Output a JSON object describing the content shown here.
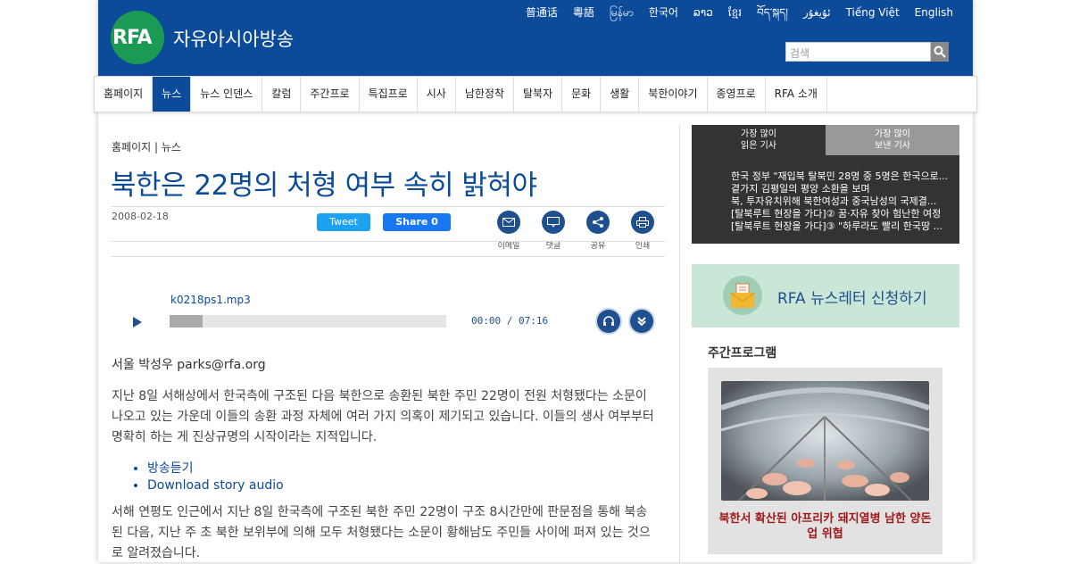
{
  "header": {
    "logo": "RFA",
    "site_name": "자유아시아방송",
    "languages": [
      "普通话",
      "粵語",
      "မြန်မာ",
      "한국어",
      "ລາວ",
      "ខ្មែរ",
      "བོད་སྐད།",
      "ئۇيغۇر",
      "Tiếng Việt",
      "English"
    ],
    "search_placeholder": "검색"
  },
  "nav": {
    "items": [
      "홈페이지",
      "뉴스",
      "뉴스 인덴스",
      "칼럼",
      "주간프로",
      "특집프로",
      "시사",
      "남한정착",
      "탈북자",
      "문화",
      "생활",
      "북한이야기",
      "종영프로",
      "RFA 소개"
    ],
    "active": "뉴스"
  },
  "article": {
    "breadcrumb": "홈페이지 | 뉴스",
    "title": "북한은 22명의 처형 여부 속히 밝혀야",
    "date": "2008-02-18",
    "tweet_label": "Tweet",
    "share_label": "Share 0",
    "tools": [
      "이메일",
      "댓글",
      "공유",
      "인쇄"
    ],
    "audio_file": "k0218ps1.mp3",
    "audio_time": "00:00 / 07:16",
    "audio_progress": 0.12,
    "byline": "서울 박성우 parks@rfa.org",
    "para1": "지난 8일 서해상에서 한국측에 구조된 다음 북한으로 송환된 북한 주민 22명이 전원 처형됐다는 소문이 나오고 있는 가운데 이들의 송환 과정 자체에 여러 가지 의혹이 제기되고 있습니다. 이들의 생사 여부부터 명확히 하는 게 진상규명의 시작이라는 지적입니다.",
    "links": [
      "방송듣기",
      "Download story audio"
    ],
    "para2": "서해 연평도 인근에서 지난 8일 한국측에 구조된 북한 주민 22명이 구조 8시간만에 판문점을 통해 북송된 다음, 지난 주 초 북한 보위부에 의해 모두 처형됐다는 소문이 황해남도 주민들 사이에 퍼져 있는 것으로 알려졌습니다."
  },
  "sidebar": {
    "tab1": [
      "가장 많이",
      "읽은 기사"
    ],
    "tab2": [
      "가장 많이",
      "보낸 기사"
    ],
    "popular": [
      "한국 정부 \"재입북 탈북민 28명 중 5명은 한국으로...",
      "곁가지 김평일의 평양 소환을 보며",
      "북, 투자유치위해 북한여성과 중국남성의 국제결...",
      "[탈북루트 현장을 가다]② 꿈·자유 찾아 험난한 여정",
      "[탈북루트 현장을 가다]③ \"하루라도 빨리 한국땅 ..."
    ],
    "newsletter": "RFA 뉴스레터 신청하기",
    "weekly_title": "주간프로그램",
    "weekly_caption": "북한서 확산된 아프리카 돼지열병 남한 양돈업 위협"
  },
  "colors": {
    "brand_blue": "#0c4a9a",
    "logo_green": "#1a9a52",
    "accent_red": "#a01818"
  }
}
